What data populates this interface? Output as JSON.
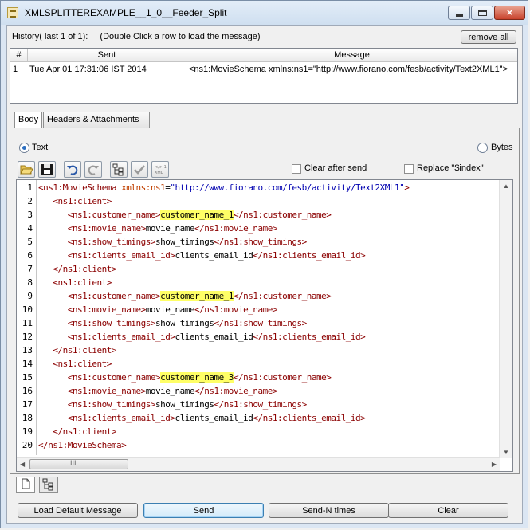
{
  "window": {
    "title": "XMLSPLITTEREXAMPLE__1_0__Feeder_Split",
    "close_glyph": "×"
  },
  "history": {
    "label": "History( last 1 of 1):",
    "hint": "(Double Click a row to load the message)",
    "remove_all_label": "remove all",
    "columns": [
      "#",
      "Sent",
      "Message"
    ],
    "rows": [
      {
        "num": "1",
        "sent": "Tue Apr 01 17:31:06 IST 2014",
        "message": "<ns1:MovieSchema xmlns:ns1=\"http://www.fiorano.com/fesb/activity/Text2XML1\">"
      }
    ]
  },
  "tabs": [
    {
      "label": "Body",
      "active": true
    },
    {
      "label": "Headers & Attachments",
      "active": false
    }
  ],
  "format": {
    "text_label": "Text",
    "bytes_label": "Bytes",
    "selected": "Text"
  },
  "toolbar": {
    "clear_after_send_label": "Clear after send",
    "replace_index_label": "Replace \"$index\"",
    "clear_after_send_checked": false,
    "replace_index_checked": false,
    "icons": [
      "open-folder-icon",
      "save-icon",
      "undo-icon",
      "redo-icon",
      "tree-view-icon",
      "validate-check-icon",
      "xml-format-icon"
    ]
  },
  "editor": {
    "line_numbers": [
      "1",
      "2",
      "3",
      "4",
      "5",
      "6",
      "7",
      "8",
      "9",
      "10",
      "11",
      "12",
      "13",
      "14",
      "15",
      "16",
      "17",
      "18",
      "19",
      "20"
    ],
    "lines": [
      [
        {
          "t": "tag",
          "v": "<ns1:MovieSchema"
        },
        {
          "t": "txt",
          "v": " "
        },
        {
          "t": "attr",
          "v": "xmlns:ns1"
        },
        {
          "t": "txt",
          "v": "="
        },
        {
          "t": "val",
          "v": "\"http://www.fiorano.com/fesb/activity/Text2XML1\""
        },
        {
          "t": "tag",
          "v": ">"
        }
      ],
      [
        {
          "t": "txt",
          "v": "   "
        },
        {
          "t": "tag",
          "v": "<ns1:client>"
        }
      ],
      [
        {
          "t": "txt",
          "v": "      "
        },
        {
          "t": "tag",
          "v": "<ns1:customer_name>"
        },
        {
          "t": "hl",
          "v": "customer_name_1"
        },
        {
          "t": "tag",
          "v": "</ns1:customer_name>"
        }
      ],
      [
        {
          "t": "txt",
          "v": "      "
        },
        {
          "t": "tag",
          "v": "<ns1:movie_name>"
        },
        {
          "t": "txt",
          "v": "movie_name"
        },
        {
          "t": "tag",
          "v": "</ns1:movie_name>"
        }
      ],
      [
        {
          "t": "txt",
          "v": "      "
        },
        {
          "t": "tag",
          "v": "<ns1:show_timings>"
        },
        {
          "t": "txt",
          "v": "show_timings"
        },
        {
          "t": "tag",
          "v": "</ns1:show_timings>"
        }
      ],
      [
        {
          "t": "txt",
          "v": "      "
        },
        {
          "t": "tag",
          "v": "<ns1:clients_email_id>"
        },
        {
          "t": "txt",
          "v": "clients_email_id"
        },
        {
          "t": "tag",
          "v": "</ns1:clients_email_id>"
        }
      ],
      [
        {
          "t": "txt",
          "v": "   "
        },
        {
          "t": "tag",
          "v": "</ns1:client>"
        }
      ],
      [
        {
          "t": "txt",
          "v": "   "
        },
        {
          "t": "tag",
          "v": "<ns1:client>"
        }
      ],
      [
        {
          "t": "txt",
          "v": "      "
        },
        {
          "t": "tag",
          "v": "<ns1:customer_name>"
        },
        {
          "t": "hl",
          "v": "customer_name_1"
        },
        {
          "t": "tag",
          "v": "</ns1:customer_name>"
        }
      ],
      [
        {
          "t": "txt",
          "v": "      "
        },
        {
          "t": "tag",
          "v": "<ns1:movie_name>"
        },
        {
          "t": "txt",
          "v": "movie_name"
        },
        {
          "t": "tag",
          "v": "</ns1:movie_name>"
        }
      ],
      [
        {
          "t": "txt",
          "v": "      "
        },
        {
          "t": "tag",
          "v": "<ns1:show_timings>"
        },
        {
          "t": "txt",
          "v": "show_timings"
        },
        {
          "t": "tag",
          "v": "</ns1:show_timings>"
        }
      ],
      [
        {
          "t": "txt",
          "v": "      "
        },
        {
          "t": "tag",
          "v": "<ns1:clients_email_id>"
        },
        {
          "t": "txt",
          "v": "clients_email_id"
        },
        {
          "t": "tag",
          "v": "</ns1:clients_email_id>"
        }
      ],
      [
        {
          "t": "txt",
          "v": "   "
        },
        {
          "t": "tag",
          "v": "</ns1:client>"
        }
      ],
      [
        {
          "t": "txt",
          "v": "   "
        },
        {
          "t": "tag",
          "v": "<ns1:client>"
        }
      ],
      [
        {
          "t": "txt",
          "v": "      "
        },
        {
          "t": "tag",
          "v": "<ns1:customer_name>"
        },
        {
          "t": "hl",
          "v": "customer_name_3"
        },
        {
          "t": "tag",
          "v": "</ns1:customer_name>"
        }
      ],
      [
        {
          "t": "txt",
          "v": "      "
        },
        {
          "t": "tag",
          "v": "<ns1:movie_name>"
        },
        {
          "t": "txt",
          "v": "movie_name"
        },
        {
          "t": "tag",
          "v": "</ns1:movie_name>"
        }
      ],
      [
        {
          "t": "txt",
          "v": "      "
        },
        {
          "t": "tag",
          "v": "<ns1:show_timings>"
        },
        {
          "t": "txt",
          "v": "show_timings"
        },
        {
          "t": "tag",
          "v": "</ns1:show_timings>"
        }
      ],
      [
        {
          "t": "txt",
          "v": "      "
        },
        {
          "t": "tag",
          "v": "<ns1:clients_email_id>"
        },
        {
          "t": "txt",
          "v": "clients_email_id"
        },
        {
          "t": "tag",
          "v": "</ns1:clients_email_id>"
        }
      ],
      [
        {
          "t": "txt",
          "v": "   "
        },
        {
          "t": "tag",
          "v": "</ns1:client>"
        }
      ],
      [
        {
          "t": "tag",
          "v": "</ns1:MovieSchema>"
        }
      ]
    ],
    "hscroll_grip": "III"
  },
  "bottom_tabs": [
    "document-icon",
    "tree-icon"
  ],
  "buttons": {
    "load_default": "Load Default Message",
    "send": "Send",
    "send_n": "Send-N times",
    "clear": "Clear"
  },
  "colors": {
    "tag": "#8b0000",
    "attribute": "#c04000",
    "value": "#0000b0",
    "highlight": "#ffff66"
  }
}
